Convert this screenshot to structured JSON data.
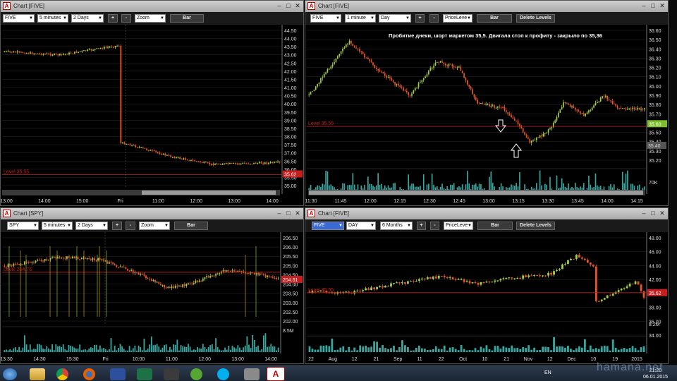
{
  "colors": {
    "bull": "#a4d04a",
    "bear": "#e8572a",
    "level": "#c81e1e",
    "grid": "#2a2a2a",
    "vol": "#3aa6a0"
  },
  "windows": [
    {
      "title": "Chart [FIVE]",
      "toolbar": {
        "symbol": "FIVE",
        "interval": "5 minutes",
        "range": "2 Days",
        "zoom": "Zoom",
        "plus": "+",
        "minus": "-",
        "type_button": "Bar"
      },
      "level_label": "Level 35.55",
      "last_price": "35.62",
      "y_ticks": [
        "44.50",
        "44.00",
        "43.50",
        "43.00",
        "42.50",
        "42.00",
        "41.50",
        "41.00",
        "40.50",
        "40.00",
        "39.50",
        "39.00",
        "38.50",
        "38.00",
        "37.50",
        "37.00",
        "36.50",
        "36.00",
        "35.50",
        "35.00"
      ],
      "x_ticks": [
        "13:00",
        "14:00",
        "15:00",
        "Fri",
        "11:00",
        "12:00",
        "13:00",
        "14:00"
      ]
    },
    {
      "title": "Chart [FIVE]",
      "toolbar": {
        "symbol": "FIVE",
        "interval": "1 minute",
        "range": "Day",
        "plus": "+",
        "minus": "-",
        "indicator": "PriceLeve",
        "type_button": "Bar",
        "delete_button": "Delete Levels"
      },
      "annotation": "Пробитие днеки, шорт маркетом 35,5. Двигала стоп к профиту - закрыло по 35,36",
      "level_label": "Level 35.55",
      "last_price": "35.60",
      "cursor_price": "35.40",
      "volume_label": "70K",
      "y_ticks": [
        "36.60",
        "36.50",
        "36.40",
        "36.30",
        "36.20",
        "36.10",
        "36.00",
        "35.90",
        "35.80",
        "35.70",
        "35.60",
        "35.50",
        "35.40",
        "35.30",
        "35.20"
      ],
      "x_ticks": [
        "11:30",
        "11:45",
        "12:00",
        "12:15",
        "12:30",
        "12:45",
        "13:00",
        "13:15",
        "13:30",
        "13:45",
        "14:00",
        "14:15"
      ],
      "cursor_time": "13:12"
    },
    {
      "title": "Chart [SPY]",
      "toolbar": {
        "symbol": "SPY",
        "interval": "5 minutes",
        "range": "2 Days",
        "zoom": "Zoom",
        "plus": "+",
        "minus": "-",
        "type_button": "Bar"
      },
      "level_label": "Level 204.76",
      "last_price": "204.61",
      "volume_label": "8.5M",
      "y_ticks": [
        "206.50",
        "206.00",
        "205.50",
        "205.00",
        "204.50",
        "204.00",
        "203.50",
        "203.00",
        "202.50",
        "202.00"
      ],
      "x_ticks": [
        "13:30",
        "14:30",
        "15:30",
        "Fri",
        "10:00",
        "11:00",
        "12:00",
        "13:00",
        "14:00"
      ]
    },
    {
      "title": "Chart [FIVE]",
      "toolbar": {
        "symbol": "FIVE",
        "interval": "DAY",
        "range": "6 Months",
        "plus": "+",
        "minus": "-",
        "indicator": "PriceLeve",
        "type_button": "Bar",
        "delete_button": "Delete Levels"
      },
      "level_label": "Level 35.55",
      "last_price": "35.62",
      "volume_label": "8.2M",
      "y_ticks": [
        "48.00",
        "46.00",
        "44.00",
        "42.00",
        "40.00",
        "38.00",
        "36.00",
        "34.00"
      ],
      "x_ticks": [
        "22",
        "Aug",
        "12",
        "21",
        "Sep",
        "11",
        "22",
        "Oct",
        "10",
        "21",
        "Nov",
        "12",
        "Dec",
        "10",
        "19",
        "2015"
      ]
    }
  ],
  "taskbar": {
    "language": "EN",
    "time": "21:20",
    "date": "06.01.2015",
    "watermark": "hamana.net",
    "icons": [
      "start-orb-icon",
      "explorer-icon",
      "chrome-icon",
      "firefox-icon",
      "save-icon",
      "excel-icon",
      "video-icon",
      "utorrent-icon",
      "skype-icon",
      "settings-icon",
      "trading-app-icon"
    ]
  }
}
